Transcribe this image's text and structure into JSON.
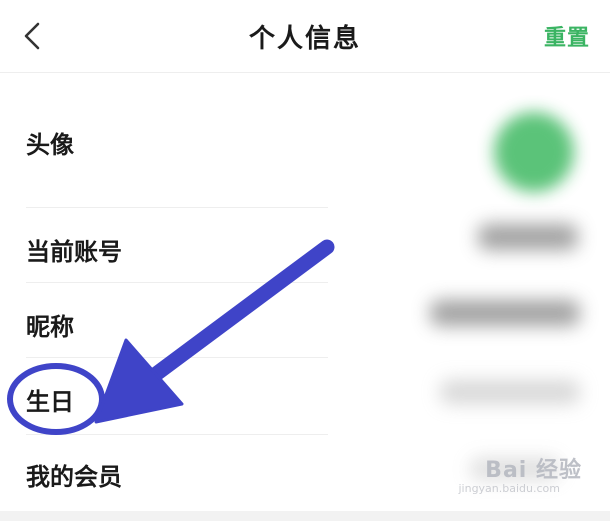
{
  "header": {
    "title": "个人信息",
    "reset_label": "重置"
  },
  "rows": [
    {
      "label": "头像"
    },
    {
      "label": "当前账号"
    },
    {
      "label": "昵称"
    },
    {
      "label": "生日"
    },
    {
      "label": "我的会员"
    }
  ],
  "annotation": {
    "arrow_color": "#3f44c8",
    "circle_color": "#3f44c8"
  },
  "colors": {
    "accent": "#3bb463",
    "avatar": "#53c072"
  },
  "watermark": {
    "text": "Bai 经验",
    "sub": "jingyan.baidu.com"
  }
}
